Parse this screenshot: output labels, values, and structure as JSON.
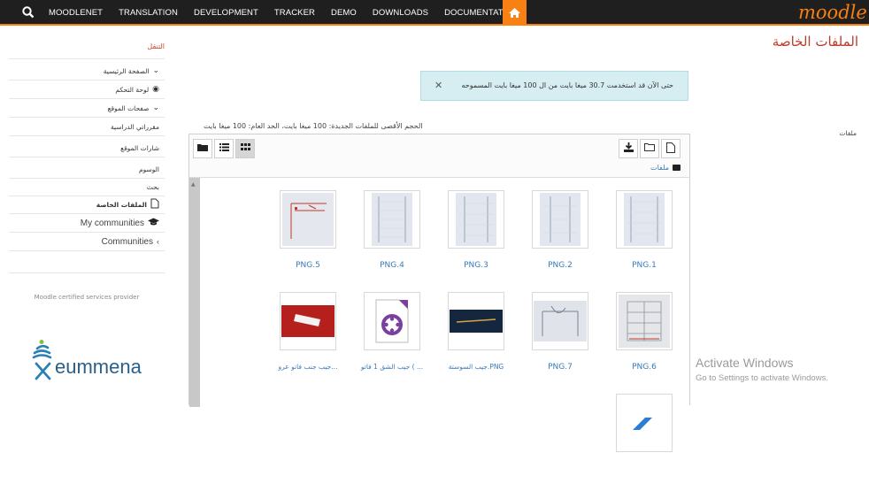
{
  "topbar": {
    "nav": [
      "MOODLENET",
      "TRANSLATION",
      "DEVELOPMENT",
      "TRACKER",
      "DEMO",
      "DOWNLOADS",
      "DOCUMENTATION"
    ],
    "logo": "moodle",
    "accent": "#f98012"
  },
  "sidebar": {
    "title": "التنقل",
    "items": [
      {
        "label": "الصفحة الرئيسية",
        "icon": "chevron-down-icon"
      },
      {
        "label": "لوحة التحكم",
        "icon": "dashboard-icon"
      },
      {
        "label": "صفحات الموقع",
        "icon": "chevron-down-icon"
      },
      {
        "label": "مقرراتي الدراسية",
        "icon": ""
      },
      {
        "label": "شارات الموقع",
        "icon": ""
      },
      {
        "label": "الوسوم",
        "icon": ""
      },
      {
        "label": "بحث",
        "icon": ""
      },
      {
        "label": "الملفات الخاصة",
        "icon": "file-icon"
      },
      {
        "label": "My communities",
        "icon": "graduation-cap-icon"
      },
      {
        "label": "Communities",
        "icon": "chevron-left-icon"
      }
    ],
    "certified": "Moodle certified services provider",
    "partner_logo": "eummena"
  },
  "main": {
    "page_title": "الملفات الخاصة",
    "alert_text": "حتى الآن قد استخدمت 30.7 ميغا بايت من ال 100 ميغا بايت المسموحه",
    "side_label": "ملفات",
    "limits": "الحجم الأقصى للملفات الجديدة: 100 ميغا بايت، الحد العام: 100 ميغا بايت",
    "breadcrumb": "ملفات"
  },
  "files": [
    {
      "name": "PNG.5",
      "thumb": "sketch-red"
    },
    {
      "name": "PNG.4",
      "thumb": "paper"
    },
    {
      "name": "PNG.3",
      "thumb": "paper"
    },
    {
      "name": "PNG.2",
      "thumb": "paper"
    },
    {
      "name": "PNG.1",
      "thumb": "paper"
    },
    {
      "name": "جيب جنب فاتو عرو...",
      "thumb": "red-fabric"
    },
    {
      "name": "جيب الشق 1 فاتو ( ...",
      "thumb": "video"
    },
    {
      "name": "جيب السوستة.PNG",
      "thumb": "dark-fabric"
    },
    {
      "name": "PNG.7",
      "thumb": "sketch-grey"
    },
    {
      "name": "PNG.6",
      "thumb": "grid-sketch"
    }
  ],
  "watermark": {
    "line1": "Activate Windows",
    "line2": "Go to Settings to activate Windows."
  }
}
